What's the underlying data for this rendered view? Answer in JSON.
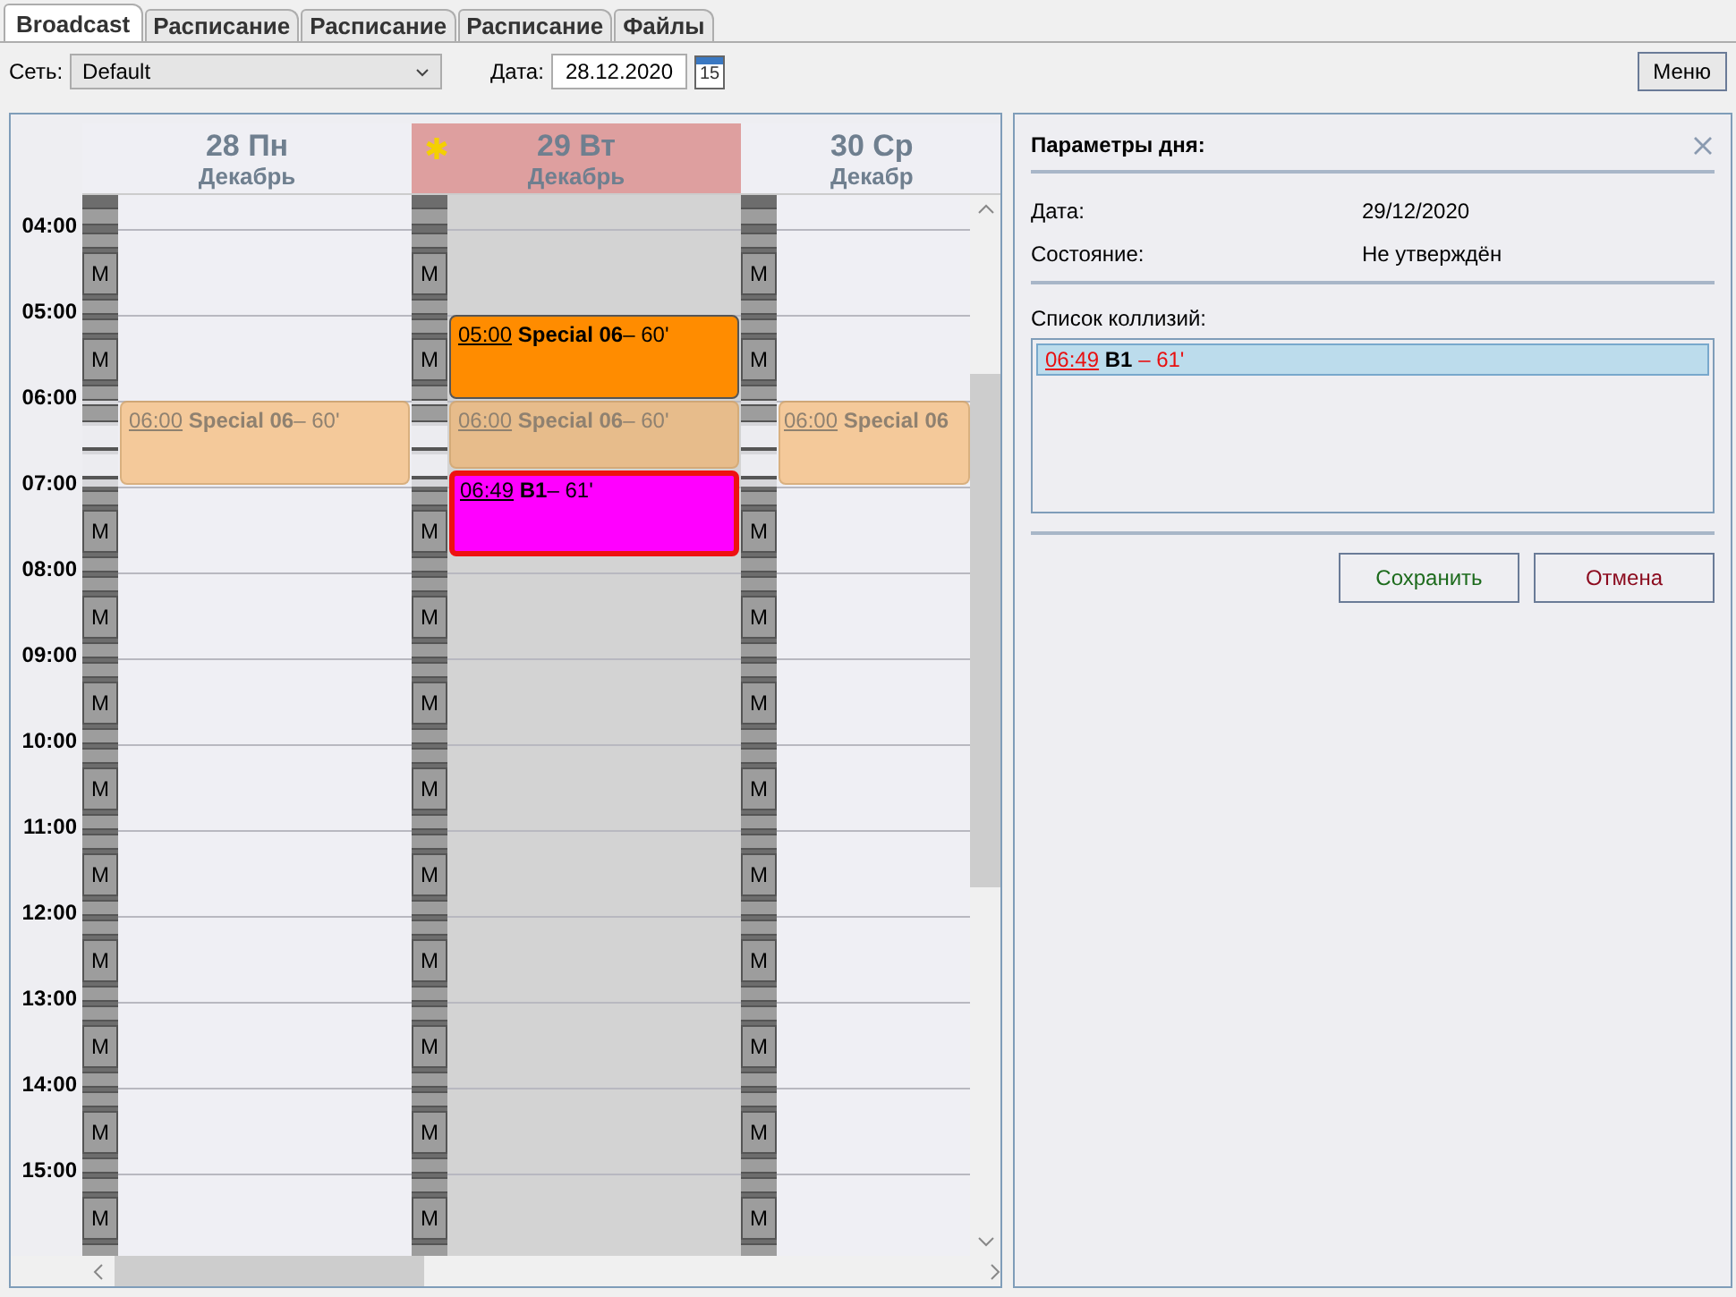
{
  "tabs": [
    {
      "label": "Broadcast",
      "selected": true
    },
    {
      "label": "Расписание",
      "selected": false
    },
    {
      "label": "Расписание",
      "selected": false
    },
    {
      "label": "Расписание",
      "selected": false
    },
    {
      "label": "Файлы",
      "selected": false
    }
  ],
  "toolbar": {
    "network_label": "Сеть:",
    "network_value": "Default",
    "date_label": "Дата:",
    "date_value": "28.12.2020",
    "calendar_day": "15",
    "menu_button": "Меню"
  },
  "calendar": {
    "time_labels": [
      "04:00",
      "05:00",
      "06:00",
      "07:00",
      "08:00",
      "09:00",
      "10:00",
      "11:00",
      "12:00",
      "13:00",
      "14:00",
      "15:00"
    ],
    "days": [
      {
        "day": "28 Пн",
        "month": "Декабрь",
        "selected": false,
        "starred": false,
        "slots": [
          {
            "kind": "marker",
            "label": "M"
          },
          {
            "kind": "marker",
            "label": "M"
          },
          {
            "kind": "gap"
          },
          {
            "kind": "marker",
            "label": "M"
          },
          {
            "kind": "marker",
            "label": "M"
          },
          {
            "kind": "marker",
            "label": "M"
          },
          {
            "kind": "marker",
            "label": "M"
          },
          {
            "kind": "marker",
            "label": "M"
          },
          {
            "kind": "marker",
            "label": "M"
          },
          {
            "kind": "marker",
            "label": "M"
          },
          {
            "kind": "marker",
            "label": "M"
          },
          {
            "kind": "marker",
            "label": "M"
          }
        ],
        "events": [
          {
            "kind": "ghost",
            "time": "06:00",
            "title": "Special 06",
            "duration": "– 60'"
          }
        ]
      },
      {
        "day": "29 Вт",
        "month": "Декабрь",
        "selected": true,
        "starred": true,
        "slots": [
          {
            "kind": "marker",
            "label": "M"
          },
          {
            "kind": "marker",
            "label": "M"
          },
          {
            "kind": "gap"
          },
          {
            "kind": "marker",
            "label": "M"
          },
          {
            "kind": "marker",
            "label": "M"
          },
          {
            "kind": "marker",
            "label": "M"
          },
          {
            "kind": "marker",
            "label": "M"
          },
          {
            "kind": "marker",
            "label": "M"
          },
          {
            "kind": "marker",
            "label": "M"
          },
          {
            "kind": "marker",
            "label": "M"
          },
          {
            "kind": "marker",
            "label": "M"
          },
          {
            "kind": "marker",
            "label": "M"
          }
        ],
        "events": [
          {
            "kind": "scheduled",
            "time": "05:00",
            "title": "Special 06",
            "duration": "– 60'"
          },
          {
            "kind": "ghost",
            "time": "06:00",
            "title": "Special 06",
            "duration": "– 60'"
          },
          {
            "kind": "collision",
            "time": "06:49",
            "title": "B1",
            "duration": "– 61'"
          }
        ]
      },
      {
        "day": "30 Ср",
        "month": "Декабр",
        "selected": false,
        "starred": false,
        "slots": [
          {
            "kind": "marker",
            "label": "M"
          },
          {
            "kind": "marker",
            "label": "M"
          },
          {
            "kind": "gap"
          },
          {
            "kind": "marker",
            "label": "M"
          },
          {
            "kind": "marker",
            "label": "M"
          },
          {
            "kind": "marker",
            "label": "M"
          },
          {
            "kind": "marker",
            "label": "M"
          },
          {
            "kind": "marker",
            "label": "M"
          },
          {
            "kind": "marker",
            "label": "M"
          },
          {
            "kind": "marker",
            "label": "M"
          },
          {
            "kind": "marker",
            "label": "M"
          },
          {
            "kind": "marker",
            "label": "M"
          }
        ],
        "events": [
          {
            "kind": "ghost",
            "time": "06:00",
            "title": "Special 06"
          }
        ]
      }
    ]
  },
  "day_panel": {
    "title": "Параметры дня:",
    "fields": [
      {
        "label": "Дата:",
        "value": "29/12/2020"
      },
      {
        "label": "Состояние:",
        "value": "Не утверждён"
      }
    ],
    "collisions_label": "Список коллизий:",
    "collisions": [
      {
        "time": "06:49",
        "title": "B1",
        "duration": "– 61'",
        "selected": true
      }
    ],
    "buttons": [
      {
        "label": "Сохранить",
        "kind": "save"
      },
      {
        "label": "Отмена",
        "kind": "cancel"
      }
    ]
  }
}
